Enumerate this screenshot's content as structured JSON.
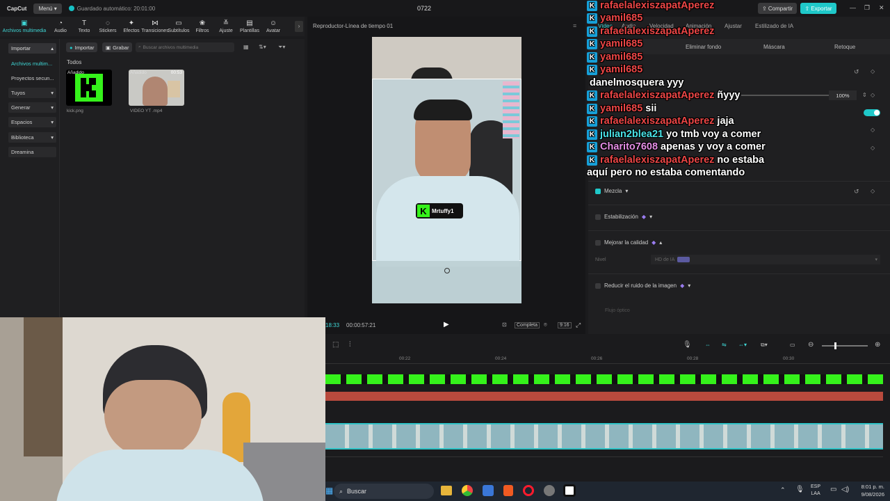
{
  "app": {
    "logo": "CapCut",
    "menu_label": "Menú",
    "autosave": "Guardado automático: 20:01:00",
    "project_name": "0722",
    "share_label": "Compartir",
    "export_label": "Exportar"
  },
  "toolbar": [
    {
      "label": "Archivos multimedia",
      "icon": "▣"
    },
    {
      "label": "Audio",
      "icon": "◔"
    },
    {
      "label": "Texto",
      "icon": "T"
    },
    {
      "label": "Stickers",
      "icon": "◌"
    },
    {
      "label": "Efectos",
      "icon": "✦"
    },
    {
      "label": "Transiciones",
      "icon": "⋈"
    },
    {
      "label": "Subtítulos",
      "icon": "▭"
    },
    {
      "label": "Filtros",
      "icon": "❀"
    },
    {
      "label": "Ajuste",
      "icon": "≚"
    },
    {
      "label": "Plantillas",
      "icon": "▤"
    },
    {
      "label": "Avatar",
      "icon": "☺"
    }
  ],
  "leftnav": {
    "import": "Importar",
    "items": [
      "Archivos multim...",
      "Proyectos secun...",
      "Tuyos",
      "Generar",
      "Espacios",
      "Biblioteca",
      "Dreamina"
    ]
  },
  "media": {
    "import_btn": "Importar",
    "record_btn": "Grabar",
    "search_placeholder": "Buscar archivos multimedia",
    "section": "Todos",
    "files": [
      {
        "name": "kick.png",
        "added": "Añadido"
      },
      {
        "name": "VIDEO YT .mp4",
        "added": "Añadido",
        "duration": "00:53"
      }
    ]
  },
  "player": {
    "title": "Reproductor-Línea de tiempo 01",
    "time_current": "18:33",
    "time_total": "00:00:57:21",
    "quality_label": "Completa",
    "ratio_label": "9:16",
    "overlay_name": "Mrtuffy1"
  },
  "rightpanel": {
    "tabs": [
      "Vídeo",
      "Audio",
      "Velocidad",
      "Animación",
      "Ajustar",
      "Estilizado de IA"
    ],
    "subtabs": [
      "Eliminar fondo",
      "Máscara",
      "Retoque"
    ],
    "scale_value": "100%",
    "props": {
      "blend": "Mezcla",
      "stabilize": "Estabilización",
      "improve": "Mejorar la calidad",
      "level": "Nivel",
      "level_value": "HD de IA",
      "denoise": "Reducir el ruido de la imagen",
      "optical": "Flujo óptico"
    }
  },
  "chat": [
    {
      "user": "rafaelalexiszapatAperez",
      "color": "#ec4646",
      "text": ""
    },
    {
      "user": "yamil685",
      "color": "#ec4646",
      "text": ""
    },
    {
      "user": "rafaelalexiszapatAperez",
      "color": "#ec4646",
      "text": ""
    },
    {
      "user": "yamil685",
      "color": "#ec4646",
      "text": ""
    },
    {
      "user": "yamil685",
      "color": "#ec4646",
      "text": ""
    },
    {
      "user": "yamil685",
      "color": "#ec4646",
      "text": ""
    },
    {
      "user": "danelmosquera",
      "color": "#ffffff",
      "text": "yyy"
    },
    {
      "user": "rafaelalexiszapatAperez",
      "color": "#ec4646",
      "text": "ñyyy"
    },
    {
      "user": "yamil685",
      "color": "#ec4646",
      "text": "sii"
    },
    {
      "user": "rafaelalexiszapatAperez",
      "color": "#ec4646",
      "text": "jaja"
    },
    {
      "user": "julian2blea21",
      "color": "#49e2e6",
      "text": "yo tmb voy a comer"
    },
    {
      "user": "Charito7608",
      "color": "#e58fe6",
      "text": "apenas y voy a comer"
    },
    {
      "user": "rafaelalexiszapatAperez",
      "color": "#ec4646",
      "text": "no estaba"
    },
    {
      "user": "",
      "color": "#ffffff",
      "text": "aquí pero no estaba comentando"
    }
  ],
  "timeline": {
    "ticks": [
      "00:22",
      "00:24",
      "00:26",
      "00:28",
      "00:30"
    ]
  },
  "taskbar": {
    "search": "Buscar",
    "lang_top": "ESP",
    "lang_bottom": "LAA",
    "time": "8:01 p. m.",
    "date": "9/08/2026"
  }
}
